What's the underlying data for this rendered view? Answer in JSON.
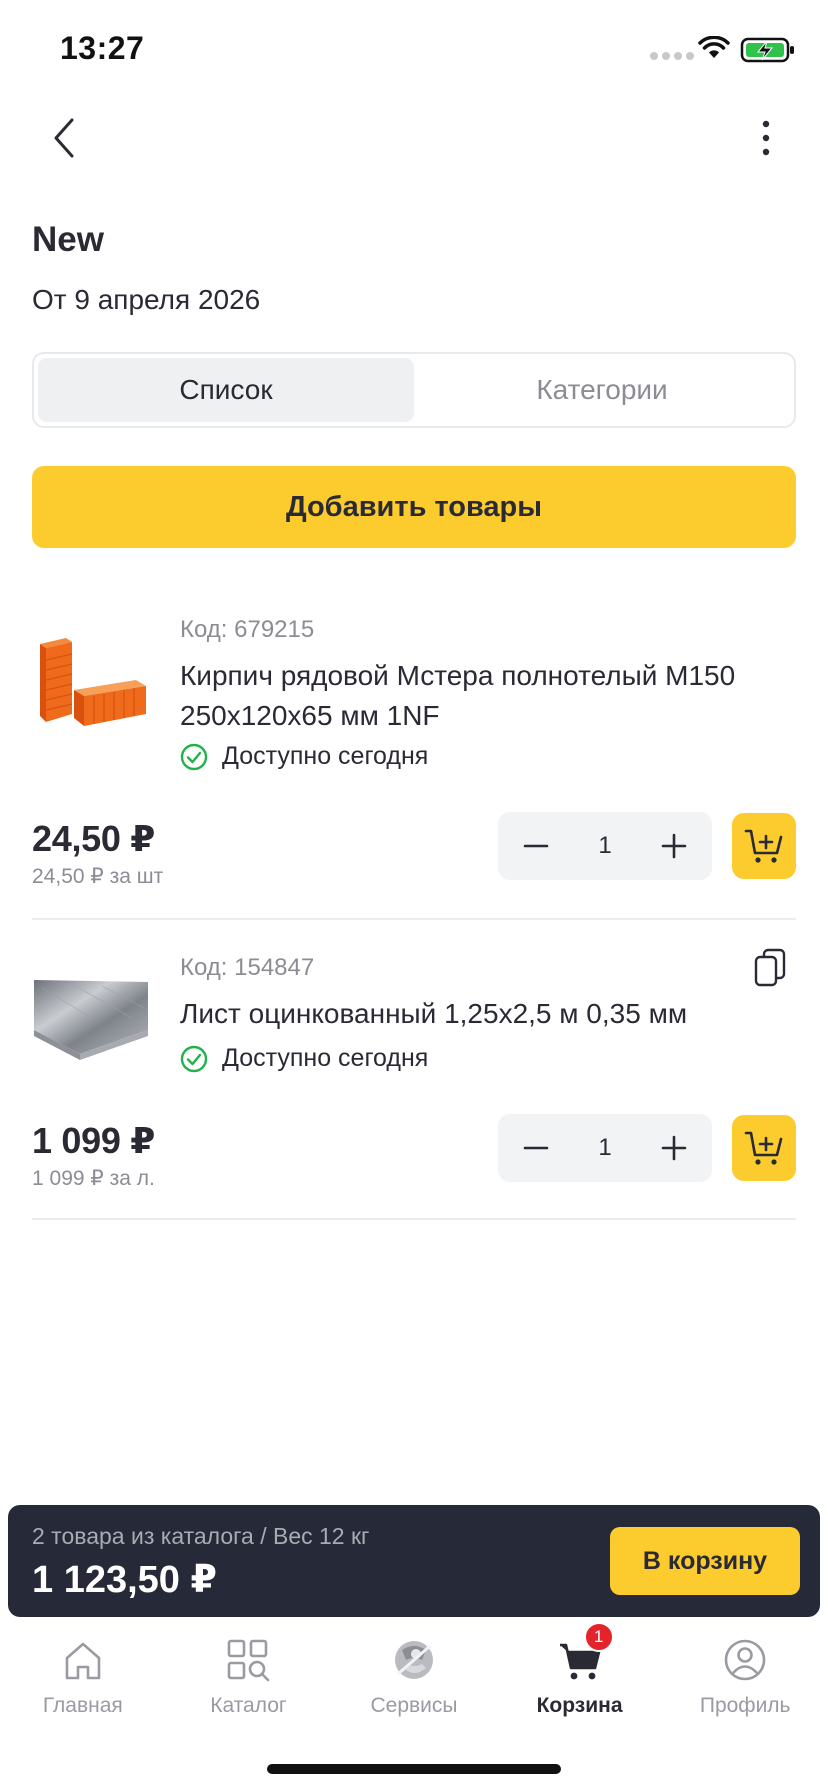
{
  "status_bar": {
    "time": "13:27"
  },
  "header": {
    "title": "New",
    "date": "От 9 апреля 2026"
  },
  "segmented": {
    "list_label": "Список",
    "categories_label": "Категории"
  },
  "add_goods_label": "Добавить товары",
  "products": [
    {
      "code": "Код: 679215",
      "name": "Кирпич рядовой Мстера полнотелый М150 250х120х65 мм 1NF",
      "availability": "Доступно сегодня",
      "price": "24,50 ₽",
      "unit_price": "24,50 ₽ за шт",
      "quantity": "1",
      "thumb_icon": "brick-image"
    },
    {
      "code": "Код: 154847",
      "name": "Лист оцинкованный 1,25х2,5 м 0,35 мм",
      "availability": "Доступно сегодня",
      "price": "1 099 ₽",
      "unit_price": "1 099 ₽ за л.",
      "quantity": "1",
      "thumb_icon": "metal-sheet-image"
    }
  ],
  "summary": {
    "info": "2 товара из каталога / Вес 12 кг",
    "total": "1 123,50 ₽",
    "to_cart_label": "В корзину"
  },
  "tabbar": {
    "items": [
      {
        "label": "Главная",
        "icon": "home-icon"
      },
      {
        "label": "Каталог",
        "icon": "catalog-icon"
      },
      {
        "label": "Сервисы",
        "icon": "services-icon"
      },
      {
        "label": "Корзина",
        "icon": "cart-icon",
        "badge": "1"
      },
      {
        "label": "Профиль",
        "icon": "profile-icon"
      }
    ],
    "active": "Корзина"
  },
  "colors": {
    "accent": "#fccb2e",
    "dark": "#262a38",
    "success": "#21b24b",
    "badge": "#e5232b"
  }
}
